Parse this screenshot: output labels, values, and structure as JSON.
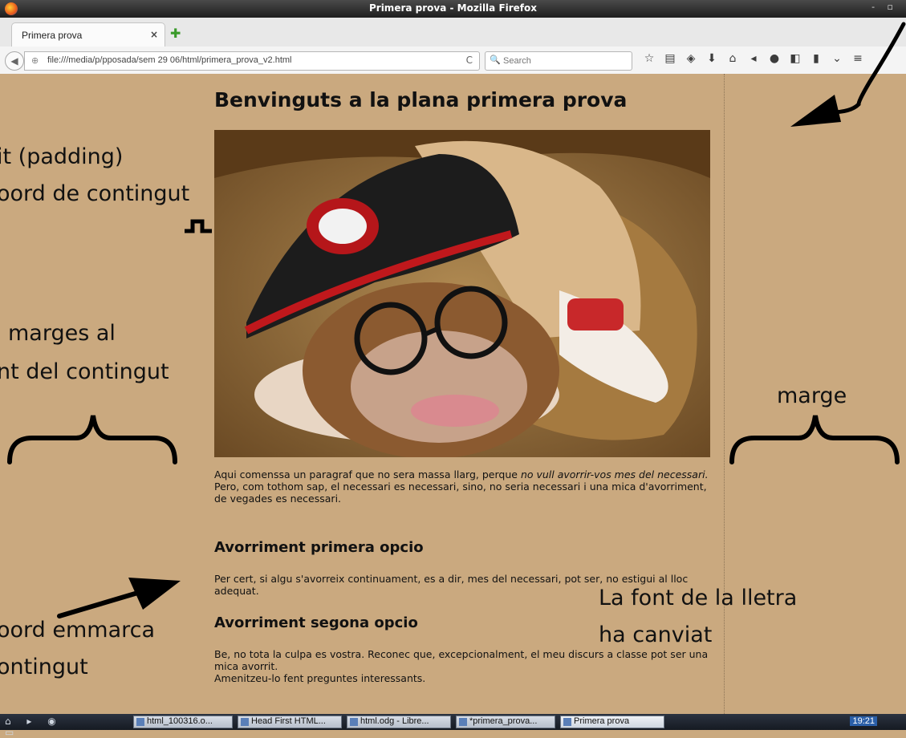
{
  "window": {
    "title": "Primera prova - Mozilla Firefox",
    "controls": "- ▫"
  },
  "tabs": [
    {
      "label": "Primera prova",
      "close": "×"
    }
  ],
  "new_tab": "✚",
  "navbar": {
    "back": "◀",
    "globe": "⊕",
    "url": "file:///media/p/pposada/sem 29 06/html/primera_prova_v2.html",
    "reload": "C",
    "search_icon": "🔍",
    "search_placeholder": "Search",
    "icons": [
      "star-icon",
      "reading-list-icon",
      "pocket-icon",
      "download-icon",
      "home-icon",
      "send-icon",
      "chat-icon",
      "extension-icon",
      "menu-extension-icon",
      "overflow-icon",
      "hamburger-icon"
    ],
    "icon_glyphs": [
      "☆",
      "▤",
      "◈",
      "⬇",
      "⌂",
      "◂",
      "●",
      "◧",
      "▮",
      "⌄",
      "≡"
    ]
  },
  "page": {
    "heading": "Benvinguts a la plana primera prova",
    "para1_start": "Aqui comenssa un paragraf que no sera massa llarg, perque ",
    "para1_em": "no vull avorrir-vos mes del necessari.",
    "para1_line2": "Pero, com tothom sap, el necessari es necessari, sino, no seria necessari i una mica d'avorriment, de vegades es necessari.",
    "h2_1": "Avorriment primera opcio",
    "para2": "Per cert, si algu s'avorreix continuament, es a dir, mes del necessari, pot ser, no estigui al lloc adequat.",
    "h2_2": "Avorriment segona opcio",
    "para3_l1": "Be, no tota la culpa es vostra. Reconec que, excepcionalment, el meu discurs a classe pot ser una mica avorrit.",
    "para3_l2": "Amenitzeu-lo fent preguntes interessants."
  },
  "annotations": {
    "a1": "it (padding)",
    "a2": "oord de contingut",
    "a3": "marges al",
    "a4": "nt del contingut",
    "a5": "marge",
    "a6": "La font de la lletra",
    "a7": "ha canviat",
    "a8": "oord emmarca",
    "a9": "ontingut"
  },
  "taskbar": {
    "start": "⌂ ▸ ◉ ▭",
    "items": [
      "html_100316.o...",
      "Head First HTML...",
      "html.odg - Libre...",
      "*primera_prova...",
      "Primera prova"
    ],
    "clock": "19:21"
  }
}
